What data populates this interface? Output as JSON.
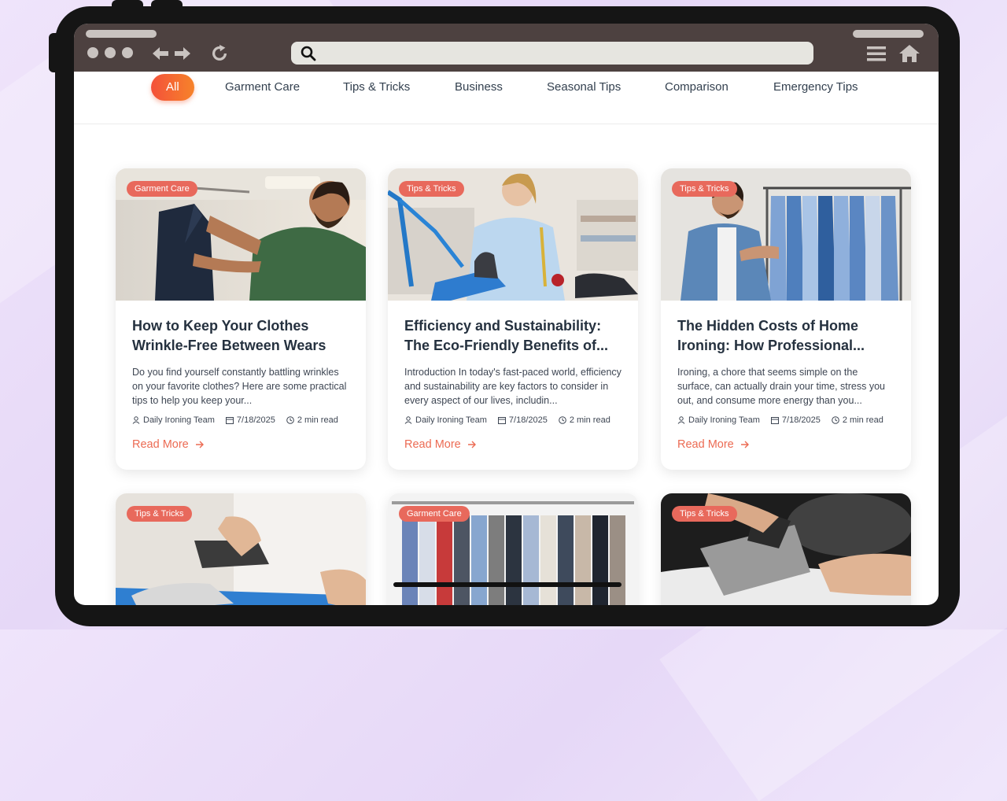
{
  "filters": [
    "All",
    "Garment Care",
    "Tips & Tricks",
    "Business",
    "Seasonal Tips",
    "Comparison",
    "Emergency Tips"
  ],
  "active_filter": "All",
  "accent_color": "#ec6b53",
  "posts": [
    {
      "category": "Garment Care",
      "title": "How to Keep Your Clothes Wrinkle-Free Between Wears",
      "excerpt": "Do you find yourself constantly battling wrinkles on your favorite clothes? Here are some practical tips to help you keep your...",
      "author": "Daily Ironing Team",
      "date": "7/18/2025",
      "read_time": "2 min read",
      "cta": "Read More"
    },
    {
      "category": "Tips & Tricks",
      "title": "Efficiency and Sustainability: The Eco-Friendly Benefits of...",
      "excerpt": "Introduction In today's fast-paced world, efficiency and sustainability are key factors to consider in every aspect of our lives, includin...",
      "author": "Daily Ironing Team",
      "date": "7/18/2025",
      "read_time": "2 min read",
      "cta": "Read More"
    },
    {
      "category": "Tips & Tricks",
      "title": "The Hidden Costs of Home Ironing: How Professional...",
      "excerpt": "Ironing, a chore that seems simple on the surface, can actually drain your time, stress you out, and consume more energy than you...",
      "author": "Daily Ironing Team",
      "date": "7/18/2025",
      "read_time": "2 min read",
      "cta": "Read More"
    },
    {
      "category": "Tips & Tricks"
    },
    {
      "category": "Garment Care"
    },
    {
      "category": "Tips & Tricks"
    }
  ]
}
